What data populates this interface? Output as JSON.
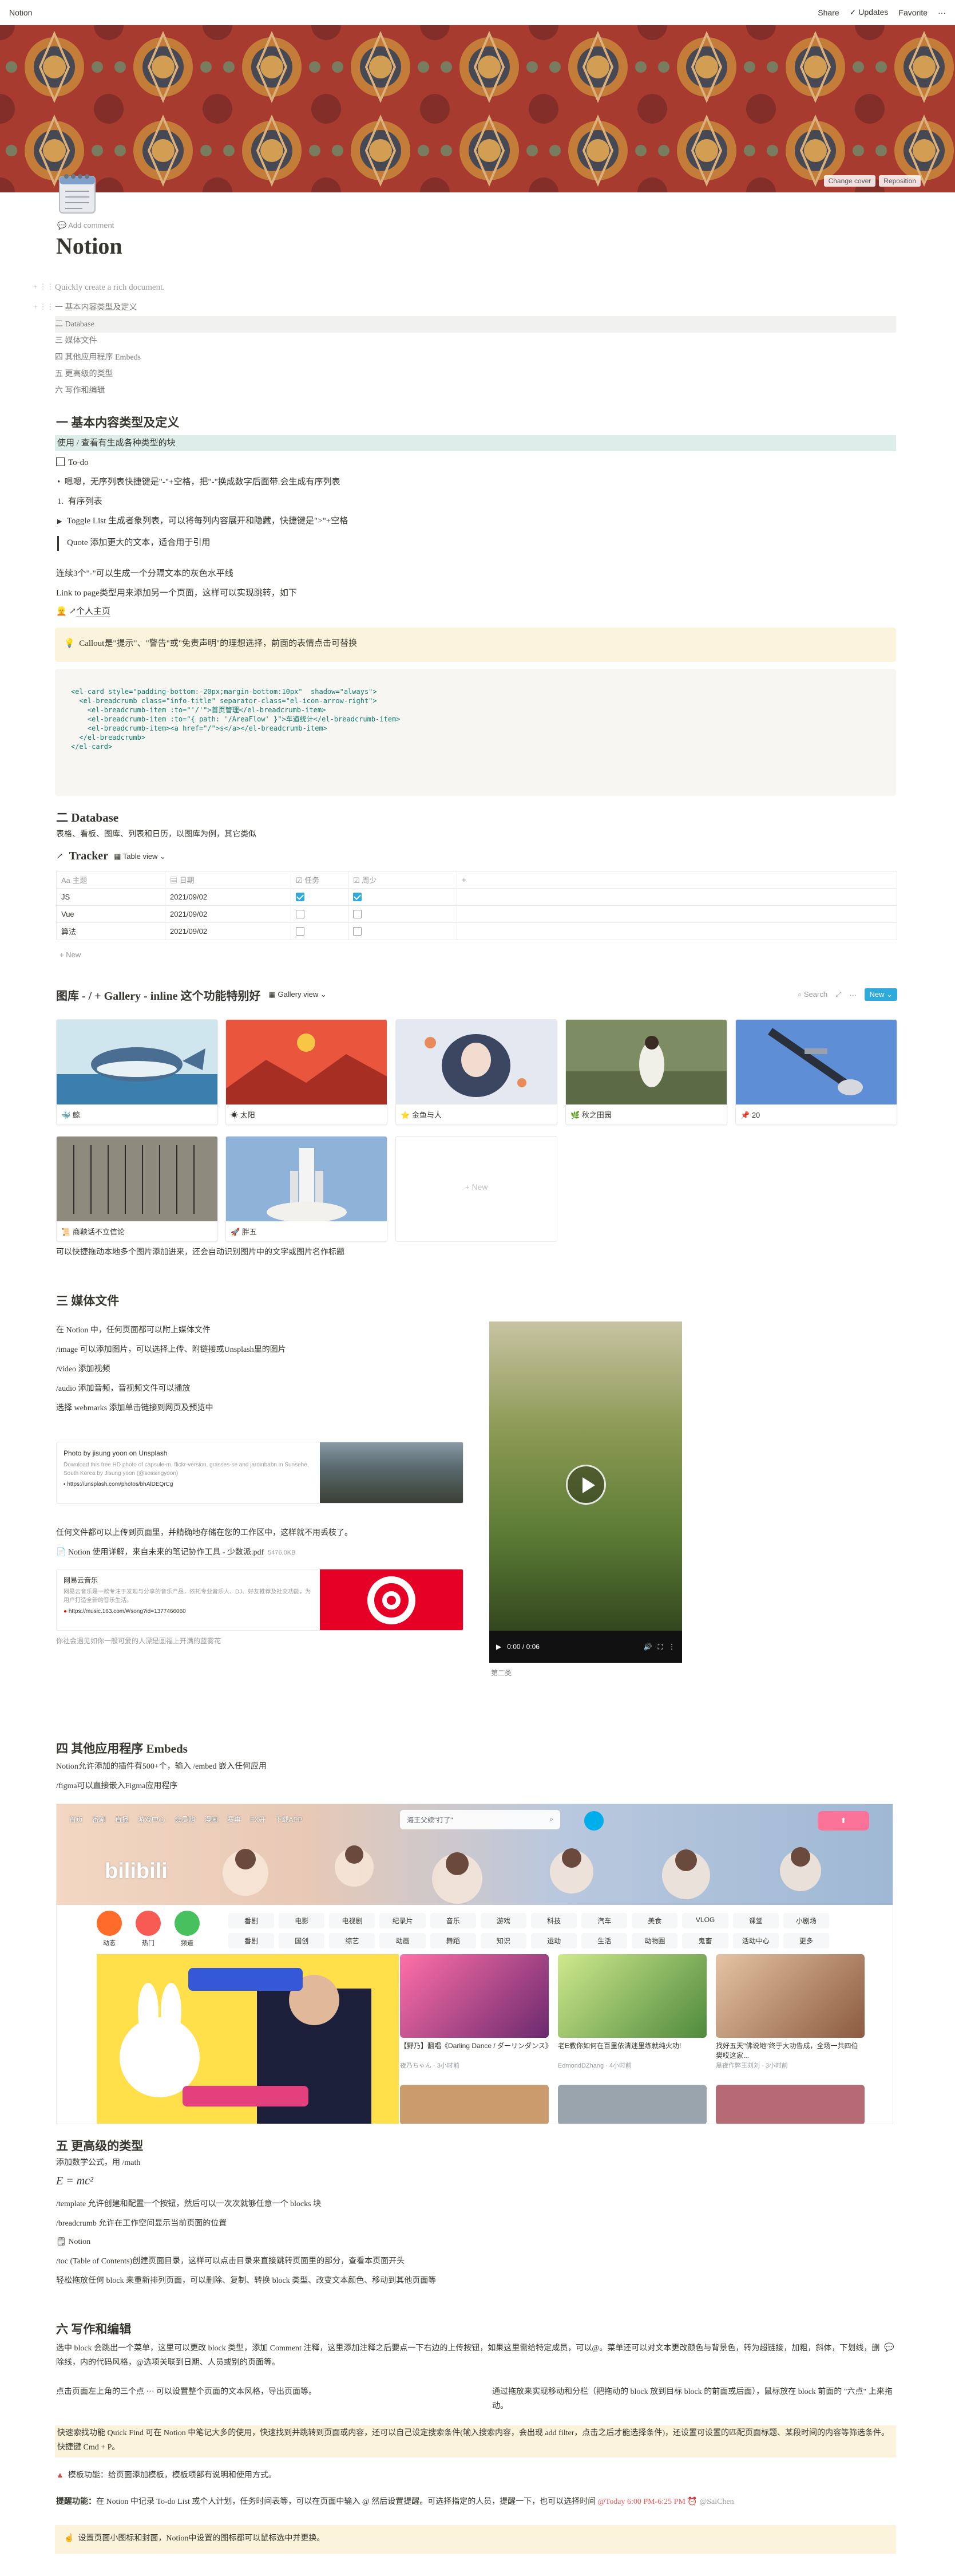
{
  "topbar": {
    "breadcrumb": "Notion",
    "share": "Share",
    "updates": "Updates",
    "favorite": "Favorite",
    "more": "···"
  },
  "cover": {
    "change_cover": "Change cover",
    "reposition": "Reposition"
  },
  "page": {
    "add_comment": "Add comment",
    "title": "Notion",
    "quick_create": "Quickly create a rich document."
  },
  "toc": [
    "一 基本内容类型及定义",
    "二 Database",
    "三 媒体文件",
    "四 其他应用程序 Embeds",
    "五 更高级的类型",
    "六 写作和编辑"
  ],
  "sec1": {
    "heading": "一 基本内容类型及定义",
    "highlight": "使用 / 查看有生成各种类型的块",
    "todo": "To-do",
    "bullet": "嗯嗯，无序列表快捷键是\"-\"+空格，把\"-\"换成数字后面带.会生成有序列表",
    "numbered": "有序列表",
    "toggle": "Toggle List 生成者象列表，可以将每列内容展开和隐藏，快捷键是\">\"+空格",
    "quote": "Quote 添加更大的文本，适合用于引用",
    "divider_note": "连续3个\"-\"可以生成一个分隔文本的灰色水平线",
    "link_note": "Link to page类型用来添加另一个页面，这样可以实现跳转，如下",
    "link_page": "个人主页",
    "callout": "Callout是\"提示\"、\"警告\"或\"免责声明\"的理想选择，前面的表情点击可替换"
  },
  "code_lines": [
    "<el-card style=\"padding-bottom:-20px;margin-bottom:10px\"  shadow=\"always\">",
    "  <el-breadcrumb class=\"info-title\" separator-class=\"el-icon-arrow-right\">",
    "    <el-breadcrumb-item :to=\"'/'\">首页管理</el-breadcrumb-item>",
    "    <el-breadcrumb-item :to=\"{ path: '/AreaFlow' }\">车道统计</el-breadcrumb-item>",
    "    <el-breadcrumb-item><a href=\"/\">s</a></el-breadcrumb-item>",
    "  </el-breadcrumb>",
    "</el-card>"
  ],
  "sec2": {
    "heading": "二 Database",
    "desc": "表格、看板、图库、列表和日历，以图库为例，其它类似",
    "tracker_title": "Tracker",
    "table_view": "Table view",
    "columns": [
      "主题",
      "日期",
      "任务",
      "周少"
    ],
    "rows": [
      {
        "name": "JS",
        "date": "2021/09/02",
        "task": true,
        "week": true
      },
      {
        "name": "Vue",
        "date": "2021/09/02",
        "task": false,
        "week": false
      },
      {
        "name": "算法",
        "date": "2021/09/02",
        "task": false,
        "week": false
      }
    ],
    "add_new": "+ New",
    "gallery_title": "图库 - / + Gallery - inline 这个功能特别好",
    "gallery_view": "Gallery view",
    "search": "Search",
    "new_btn": "New",
    "cards": [
      "鲸",
      "太阳",
      "金鱼与人",
      "秋之田园",
      "20",
      "商鞅话不立信论",
      "胖五"
    ],
    "new_card": "+ New",
    "gallery_note": "可以快捷拖动本地多个图片添加进来，还会自动识别图片中的文字或图片名作标题"
  },
  "sec3": {
    "heading": "三 媒体文件",
    "lines": [
      "在 Notion 中，任何页面都可以附上媒体文件",
      "/image 可以添加图片，可以选择上传、附链接或Unsplash里的图片",
      "/video 添加视频",
      "/audio 添加音频，音视频文件可以播放",
      "选择 webmarks 添加单击链接到网页及预览中"
    ],
    "bookmark1_title": "Photo by jisung yoon on Unsplash",
    "bookmark1_desc": "Download this free HD photo of capsule-m, flickr-version, grasses-se and jardinbabn in Sunsehe, South Korea by Jisung yoon (@sossingyoon)",
    "bookmark1_url": "https://unsplash.com/photos/bhAlDEQrCg",
    "upload_note": "任何文件都可以上传到页面里，并精确地存储在您的工作区中，这样就不用丢枝了。",
    "pdf_name": "Notion 使用详解，来自未来的笔记协作工具 - 少数派.pdf",
    "pdf_size": "5476.0KB",
    "bookmark2_title": "网易云音乐",
    "bookmark2_desc": "网易云音乐是一款专注于发现与分享的音乐产品，依托专业音乐人、DJ、好友推荐及社交功能，为用户打造全新的音乐生活。",
    "bookmark2_url": "https://music.163.com/#/song?id=1377466060",
    "audio_note": "你社会遇见如你一般可爱的人漂是圆福上开满的蓝雾花",
    "video_time": "0:00 / 0:06",
    "video_caption": "第二类"
  },
  "sec4": {
    "heading": "四 其他应用程序 Embeds",
    "line1": "Notion允许添加的插件有500+个，输入 /embed 嵌入任何应用",
    "line2": "/figma可以直接嵌入Figma应用程序",
    "embed_nav": [
      "首页",
      "番剧",
      "直播",
      "游戏中心",
      "会员购",
      "漫画",
      "赛事",
      "FX开",
      "下载APP"
    ],
    "embed_search": "海王父续\"打了\"",
    "embed_cats": [
      "番剧",
      "电影",
      "电视剧",
      "纪录片",
      "音乐",
      "游戏",
      "科技",
      "汽车",
      "美食",
      "VLOG",
      "课堂",
      "小剧场",
      "番剧",
      "国创",
      "综艺",
      "动画",
      "舞蹈",
      "知识",
      "运动",
      "生活",
      "动物圈",
      "鬼畜",
      "活动中心",
      "更多"
    ],
    "embed_left": [
      "动态",
      "热门",
      "频道"
    ],
    "video_cards": [
      {
        "title": "【野乃】翻唱《Darling Dance / ダーリンダンス》",
        "author": "夜乃ちゃん · 3小时前"
      },
      {
        "title": "老E教你如何在百里依清迷里练就纯火功!",
        "author": "EdmondDZhang · 4小时前"
      },
      {
        "title": "找好五天\"佛说地\"终于大功告成，全场一共四伯樊哎这家...",
        "author": "黑夜作弊王刘刘 · 3小时前"
      }
    ]
  },
  "sec5": {
    "heading": "五 更高级的类型",
    "math_note": "添加数学公式，用 /math",
    "formula": "E = mc²",
    "template": "/template 允许创建和配置一个按钮，然后可以一次次就够任意一个 blocks 块",
    "breadcrumb": "/breadcrumb 允许在工作空间显示当前页面的位置",
    "notion_link": "Notion",
    "toc_line": "/toc (Table of Contents)创建页面目录，这样可以点击目录来直接跳转页面里的部分，查看本页面开头",
    "drag_line": "轻松拖放任何 block 来重新排列页面，可以删除、复制、转换 block 类型、改变文本颜色、移动到其他页面等"
  },
  "sec6": {
    "heading": "六 写作和编辑",
    "p1": "选中 block 会跳出一个菜单，这里可以更改 block 类型，添加 Comment 注释，这里添加注释之后要点一下右边的上传按钮，如果这里需给特定成员，可以@。菜单还可以对文本更改颜色与背景色，转为超链接，加粗，斜体，下划线，删除线，内的代码风格，@选项关联到日期、人员或别的页面等。",
    "col_left": "点击页面左上角的三个点 ··· 可以设置整个页面的文本风格，导出页面等。",
    "col_right": "通过拖放来实现移动和分栏（把拖动的 block 放到目标 block 的前面或后面），鼠标放在 block 前面的 \"六点\" 上来拖动。",
    "quickfind": "快速索找功能 Quick Find 可在 Notion 中笔记大多的使用，快速找到并跳转到页面或内容，还可以自己设定搜索条件(输入搜索内容，会出现 add filter，点击之后才能选择条件)，还设置可设置的匹配页面标题、某段时间的内容等筛选条件。快捷键 Cmd + P。",
    "template_tip": "模板功能：给页面添加模板，模板项部有说明和使用方式。",
    "reminder_label": "提醒功能：",
    "reminder": "在 Notion 中记录 To-do List 或个人计划，任务时间表等，可以在页面中输入 @ 然后设置提醒。可选择指定的人员，提醒一下，也可以选择时间",
    "reminder_time": "@Today 6:00 PM-6:25 PM",
    "reminder_user": "@SaiChen",
    "bottom": "设置页面小图标和封面，Notion中设置的图标都可以鼠标选中并更换。"
  },
  "colors": {
    "accent": "#2eaadc",
    "text": "#37352f",
    "muted": "#9b9a97",
    "highlight_bg": "#ddedea",
    "callout_bg": "#fbf3db",
    "code_bg": "#f7f6f3"
  }
}
